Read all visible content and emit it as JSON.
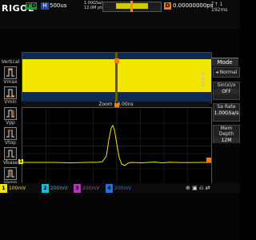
{
  "header": {
    "logo": "RIGOL",
    "run_state": "T'D",
    "mode": "H",
    "timebase": "500us",
    "sample_rate": "1.00GSa/s",
    "memory": "12.0M pts",
    "trigger_type": "D",
    "trigger_position": "0.00000000ps",
    "status_icons": "T↑ 1 192ms"
  },
  "left_panel": {
    "title": "Vertical",
    "items": [
      {
        "label": "Vmax"
      },
      {
        "label": "Vmin"
      },
      {
        "label": "Vpp"
      },
      {
        "label": "Vtop"
      },
      {
        "label": "Vbase"
      },
      {
        "label": "Vamp"
      }
    ]
  },
  "zoom_label": "Zoom 10.00ns",
  "right_menu": {
    "title": "Mode",
    "side_label": "Acquire",
    "items": [
      {
        "label": "◂ Normal",
        "value": ""
      },
      {
        "label": "Sin(x)/x",
        "value": "OFF"
      },
      {
        "label": "Sa Rate",
        "value": "1.00GSa/s"
      },
      {
        "label": "Mem Depth",
        "value": "12M"
      }
    ]
  },
  "channels": [
    {
      "num": "1",
      "value": "100mV"
    },
    {
      "num": "2",
      "value": "200mV"
    },
    {
      "num": "3",
      "value": "200mV"
    },
    {
      "num": "4",
      "value": "200mV"
    }
  ],
  "markers": {
    "ch1": "1"
  },
  "colors": {
    "ch1": "#f2e500",
    "ch2": "#23b7d8",
    "ch3": "#b03ab3",
    "ch4": "#2a6fd1",
    "trigger": "#ff7a00"
  },
  "bottom_icons": "⊕ ▣ ⎌ ⇄"
}
